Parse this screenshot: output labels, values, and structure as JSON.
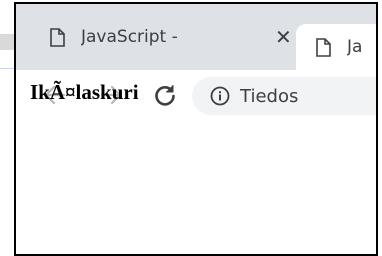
{
  "browser": {
    "tabs": [
      {
        "title": "JavaScript -",
        "close_glyph": "✕",
        "icon": "document-icon",
        "active": false
      },
      {
        "title": "Ja",
        "icon": "document-icon",
        "active": true
      }
    ],
    "toolbar": {
      "back_icon": "back-arrow-icon",
      "forward_icon": "forward-arrow-icon",
      "reload_icon": "reload-icon",
      "address_prefix": "Tiedos",
      "address_icon": "info-icon"
    }
  },
  "page": {
    "heading": "IkÃ¤laskuri"
  },
  "colors": {
    "tabstrip": "#dee1e6",
    "omnibox": "#f1f3f4",
    "text": "#3c4043",
    "icon": "#5f6368"
  }
}
